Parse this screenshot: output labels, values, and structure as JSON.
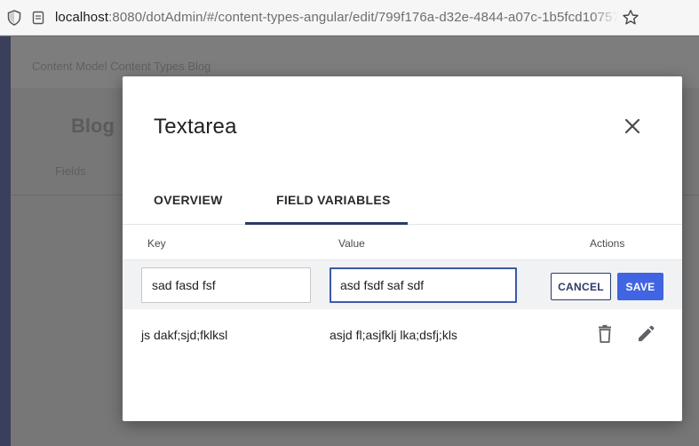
{
  "browser": {
    "url_host": "localhost",
    "url_rest": ":8080/dotAdmin/#/content-types-angular/edit/799f176a-d32e-4844-a07c-1b5fcd10757",
    "icons": {
      "shield": "shield-icon",
      "lock": "page-lock-icon",
      "star": "bookmark-star-icon"
    }
  },
  "background": {
    "breadcrumb": "Content Model   Content Types   Blog",
    "title": "Blog",
    "tab": "Fields"
  },
  "modal": {
    "title": "Textarea",
    "close_icon": "close-icon",
    "tabs": [
      {
        "label": "OVERVIEW",
        "active": false
      },
      {
        "label": "FIELD VARIABLES",
        "active": true
      }
    ],
    "table": {
      "headers": {
        "key": "Key",
        "value": "Value",
        "actions": "Actions"
      },
      "edit_row": {
        "key_value": "sad fasd fsf",
        "value_value": "asd fsdf saf sdf",
        "cancel_label": "CANCEL",
        "save_label": "SAVE"
      },
      "rows": [
        {
          "key": "js dakf;sjd;fklksl",
          "value": "asjd fl;asjfklj lka;dsfj;kls",
          "delete_icon": "trash-icon",
          "edit_icon": "pencil-icon"
        }
      ]
    }
  },
  "colors": {
    "accent": "#4164e3",
    "primary_dark": "#2b3a67",
    "focus_border": "#3d59a8"
  }
}
